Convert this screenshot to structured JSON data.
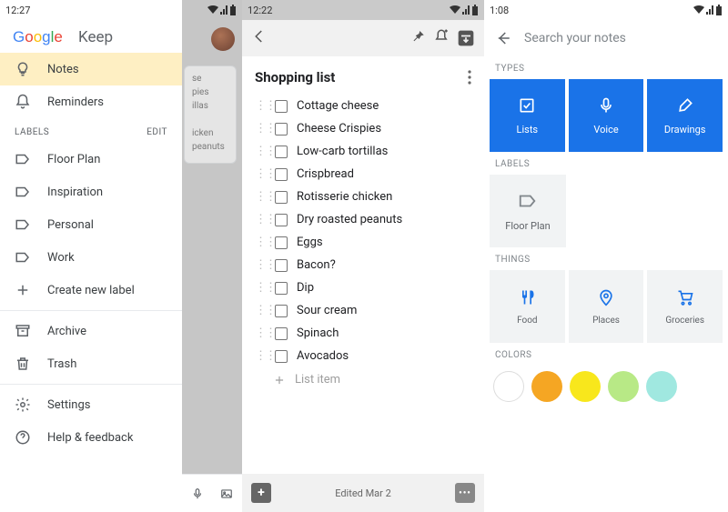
{
  "panel1": {
    "time": "12:27",
    "logo_text": "Keep",
    "nav": {
      "notes": "Notes",
      "reminders": "Reminders"
    },
    "labels_header": "LABELS",
    "labels_edit": "EDIT",
    "labels": [
      "Floor Plan",
      "Inspiration",
      "Personal",
      "Work"
    ],
    "create_label": "Create new label",
    "archive": "Archive",
    "trash": "Trash",
    "settings": "Settings",
    "help": "Help & feedback",
    "behind_lines": [
      "se",
      "pies",
      "illas",
      "",
      "icken",
      "peanuts"
    ]
  },
  "panel2": {
    "time": "12:22",
    "title": "Shopping list",
    "items": [
      "Cottage cheese",
      "Cheese Crispies",
      "Low-carb tortillas",
      "Crispbread",
      "Rotisserie chicken",
      "Dry roasted peanuts",
      "Eggs",
      "Bacon?",
      "Dip",
      "Sour cream",
      "Spinach",
      "Avocados"
    ],
    "add_placeholder": "List item",
    "edited": "Edited Mar 2"
  },
  "panel3": {
    "time": "1:08",
    "search_placeholder": "Search your notes",
    "sect_types": "TYPES",
    "types": {
      "lists": "Lists",
      "voice": "Voice",
      "drawings": "Drawings"
    },
    "sect_labels": "LABELS",
    "label_tile": "Floor Plan",
    "sect_things": "THINGS",
    "things": {
      "food": "Food",
      "places": "Places",
      "groceries": "Groceries"
    },
    "sect_colors": "COLORS",
    "colors": [
      "#ffffff",
      "#f5a623",
      "#f8e71c",
      "#b8e986",
      "#a0e8e0"
    ]
  }
}
